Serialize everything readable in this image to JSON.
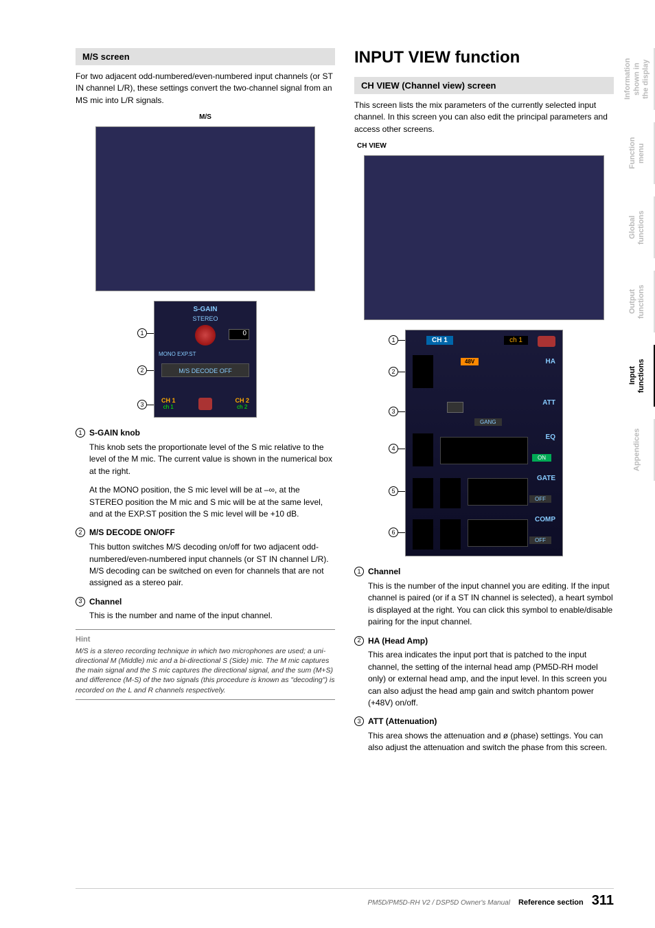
{
  "left": {
    "ms_title": "M/S screen",
    "ms_intro": "For two adjacent odd-numbered/even-numbered input channels (or ST IN channel L/R), these settings convert the two-channel signal from an MS mic into L/R signals.",
    "ms_img_label": "M/S",
    "items": [
      {
        "num": "1",
        "title": "S-GAIN knob",
        "paras": [
          "This knob sets the proportionate level of the S mic relative to the level of the M mic. The current value is shown in the numerical box at the right.",
          "At the MONO position, the S mic level will be at –∞, at the STEREO position the M mic and S mic will be at the same level, and at the EXP.ST position the S mic level will be +10 dB."
        ]
      },
      {
        "num": "2",
        "title": "M/S DECODE ON/OFF",
        "paras": [
          "This button switches M/S decoding on/off for two adjacent odd-numbered/even-numbered input channels (or ST IN channel L/R). M/S decoding can be switched on even for channels that are not assigned as a stereo pair."
        ]
      },
      {
        "num": "3",
        "title": "Channel",
        "paras": [
          "This is the number and name of the input channel."
        ]
      }
    ],
    "hint_label": "Hint",
    "hint_text": "M/S is a stereo recording technique in which two microphones are used; a uni-directional M (Middle) mic and a bi-directional S (Side) mic. The M mic captures the main signal and the S mic captures the directional signal, and the sum (M+S) and difference (M-S) of the two signals (this procedure is known as \"decoding\") is recorded on the L and R channels respectively."
  },
  "right": {
    "h1": "INPUT VIEW function",
    "chview_title": "CH VIEW (Channel view) screen",
    "chview_intro": "This screen lists the mix parameters of the currently selected input channel. In this screen you can also edit the principal parameters and access other screens.",
    "chview_img_label": "CH VIEW",
    "items": [
      {
        "num": "1",
        "title": "Channel",
        "paras": [
          "This is the number of the input channel you are editing. If the input channel is paired (or if a ST IN channel is selected), a heart symbol is displayed at the right. You can click this symbol to enable/disable pairing for the input channel."
        ]
      },
      {
        "num": "2",
        "title": "HA (Head Amp)",
        "paras": [
          "This area indicates the input port that is patched to the input channel, the setting of the internal head amp (PM5D-RH model only) or external head amp, and the input level. In this screen you can also adjust the head amp gain and switch phantom power (+48V) on/off."
        ]
      },
      {
        "num": "3",
        "title": "ATT (Attenuation)",
        "paras": [
          "This area shows the attenuation and ø (phase) settings. You can also adjust the attenuation and switch the phase from this screen."
        ]
      }
    ]
  },
  "tabs": [
    {
      "label": "Information shown in the display",
      "active": false
    },
    {
      "label": "Function menu",
      "active": false
    },
    {
      "label": "Global functions",
      "active": false
    },
    {
      "label": "Output functions",
      "active": false
    },
    {
      "label": "Input functions",
      "active": true
    },
    {
      "label": "Appendices",
      "active": false
    }
  ],
  "footer": {
    "manual": "PM5D/PM5D-RH V2 / DSP5D Owner's Manual",
    "section": "Reference section",
    "page": "311"
  },
  "detail_labels": {
    "sgain": "S-GAIN",
    "stereo": "STEREO",
    "mono": "MONO EXP.ST",
    "decode": "M/S DECODE OFF",
    "ch1": "CH 1",
    "ch2": "CH 2",
    "ch1l": "ch 1",
    "ch2l": "ch 2"
  }
}
